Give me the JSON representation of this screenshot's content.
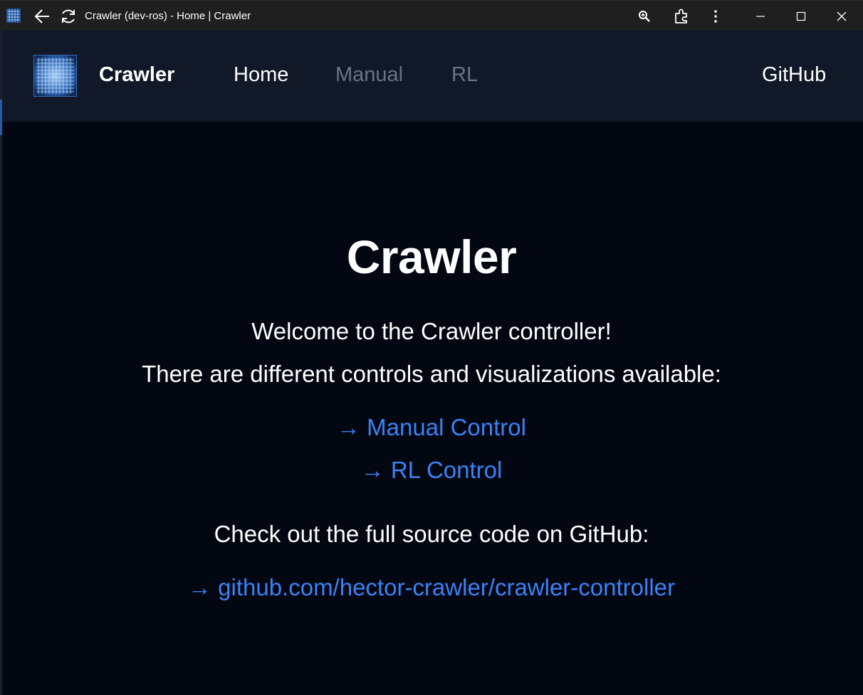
{
  "window": {
    "title": "Crawler (dev-ros) - Home | Crawler",
    "icons": {
      "app": "app-grid-icon",
      "back": "back-arrow-icon",
      "reload": "reload-icon",
      "zoom": "zoom-icon",
      "extensions": "extensions-icon",
      "more": "more-vertical-icon",
      "minimize": "minimize-icon",
      "maximize": "maximize-icon",
      "close": "close-icon"
    }
  },
  "navbar": {
    "brand": "Crawler",
    "links": {
      "home": "Home",
      "manual": "Manual",
      "rl": "RL",
      "github": "GitHub"
    }
  },
  "main": {
    "title": "Crawler",
    "welcome": "Welcome to the Crawler controller!",
    "subtitle": "There are different controls and visualizations available:",
    "manual_link": "→ Manual Control",
    "rl_link": "→ RL Control",
    "source_text": "Check out the full source code on GitHub:",
    "repo_link": "→ github.com/hector-crawler/crawler-controller"
  },
  "colors": {
    "background": "#030712",
    "navbar": "#111827",
    "link": "#3b82f6",
    "inactive_nav": "#6b7280",
    "titlebar": "#1f1f1f"
  }
}
